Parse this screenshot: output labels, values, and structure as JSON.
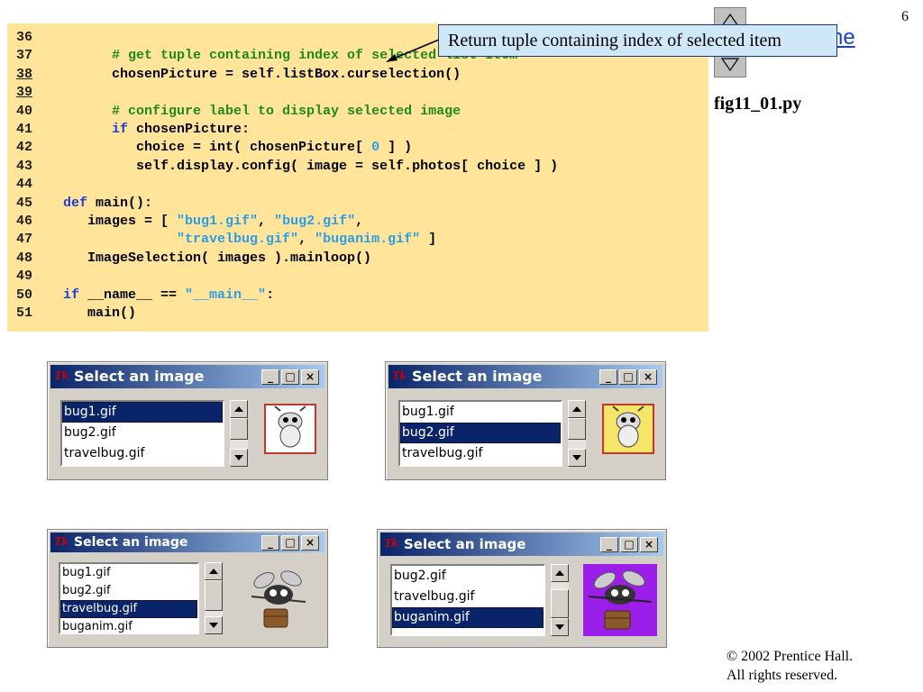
{
  "slide": {
    "page_number": "6",
    "file_label": "fig11_01.py",
    "outline_partial": "ne",
    "copyright_line1": "© 2002 Prentice Hall.",
    "copyright_line2": "All rights reserved."
  },
  "callout": {
    "text": "Return tuple containing index of selected item"
  },
  "code": {
    "lines": [
      {
        "num": "36",
        "src": ""
      },
      {
        "num": "37",
        "src": "      # get tuple containing index of selected list item"
      },
      {
        "num": "38",
        "src": "      chosenPicture = self.listBox.curselection()"
      },
      {
        "num": "39",
        "src": ""
      },
      {
        "num": "40",
        "src": "      # configure label to display selected image"
      },
      {
        "num": "41",
        "src": "      if chosenPicture:"
      },
      {
        "num": "42",
        "src": "         choice = int( chosenPicture[ 0 ] )"
      },
      {
        "num": "43",
        "src": "         self.display.config( image = self.photos[ choice ] )"
      },
      {
        "num": "44",
        "src": ""
      },
      {
        "num": "45",
        "src": "def main():"
      },
      {
        "num": "46",
        "src": "   images = [ \"bug1.gif\", \"bug2.gif\","
      },
      {
        "num": "47",
        "src": "              \"travelbug.gif\", \"buganim.gif\" ]"
      },
      {
        "num": "48",
        "src": "   ImageSelection( images ).mainloop()"
      },
      {
        "num": "49",
        "src": ""
      },
      {
        "num": "50",
        "src": "if __name__ == \"__main__\":"
      },
      {
        "num": "51",
        "src": "   main()"
      }
    ]
  },
  "windows": [
    {
      "title": "Select an image",
      "items": [
        "bug1.gif",
        "bug2.gif",
        "travelbug.gif"
      ],
      "selected_index": 0,
      "image_name": "bug1-image"
    },
    {
      "title": "Select an image",
      "items": [
        "bug1.gif",
        "bug2.gif",
        "travelbug.gif"
      ],
      "selected_index": 1,
      "image_name": "bug2-image"
    },
    {
      "title": "Select an image",
      "items": [
        "bug1.gif",
        "bug2.gif",
        "travelbug.gif",
        "buganim.gif"
      ],
      "selected_index": 2,
      "image_name": "travelbug-image"
    },
    {
      "title": "Select an image",
      "items": [
        "bug2.gif",
        "travelbug.gif",
        "buganim.gif"
      ],
      "selected_index": 2,
      "image_name": "buganim-image"
    }
  ],
  "titlebar_buttons": {
    "minimize": "_",
    "maximize": "□",
    "close": "×"
  },
  "tk_icon_text": "Tk",
  "colors": {
    "code_bg": "#ffe49a",
    "comment": "#1e8a1e",
    "keyword": "#1a3ed8",
    "string": "#2a9ee8",
    "callout_bg": "#cfe8f8",
    "selection": "#0a246a"
  }
}
